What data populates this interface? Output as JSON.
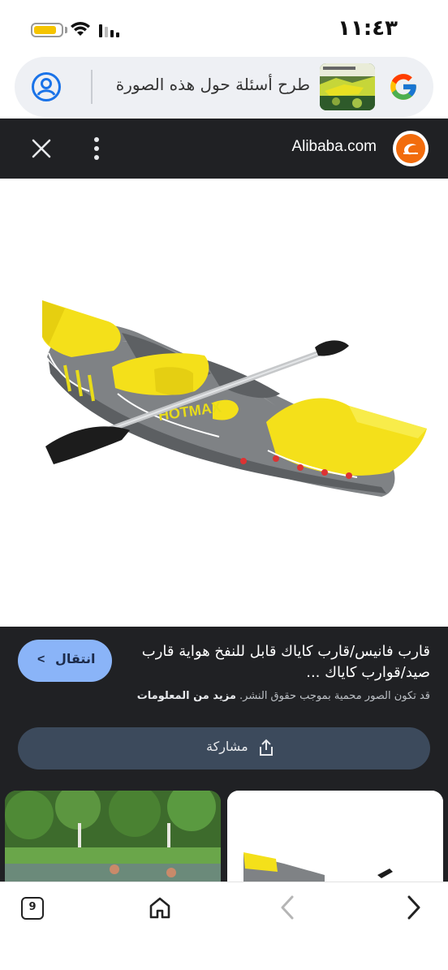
{
  "status_bar": {
    "time": "١١:٤٣",
    "battery_level": 0.85
  },
  "search": {
    "placeholder": "طرح أسئلة حول هذه الصورة",
    "icon_left": "account-icon",
    "icon_right": "google-logo"
  },
  "site": {
    "name": "Alibaba.com",
    "logo_icon": "alibaba-logo",
    "close_icon": "close-icon",
    "menu_icon": "more-vert-icon"
  },
  "result": {
    "title": "قارب فانيس/قارب كاياك قابل للنفخ هواية قارب صيد/قوارب كاياك ...",
    "copyright_note": "قد تكون الصور محمية بموجب حقوق النشر.",
    "more_info": "مزيد من المعلومات",
    "visit_label": "انتقال",
    "share_label": "مشاركة"
  },
  "product_image": {
    "brand_text": "HOTMAX"
  },
  "bottom_nav": {
    "tab_count": "9"
  },
  "colors": {
    "header_bg": "#202124",
    "visit_button": "#8ab4f8",
    "share_button": "#3c4a5c",
    "kayak_yellow": "#f4e01a",
    "kayak_gray": "#7e8184"
  }
}
